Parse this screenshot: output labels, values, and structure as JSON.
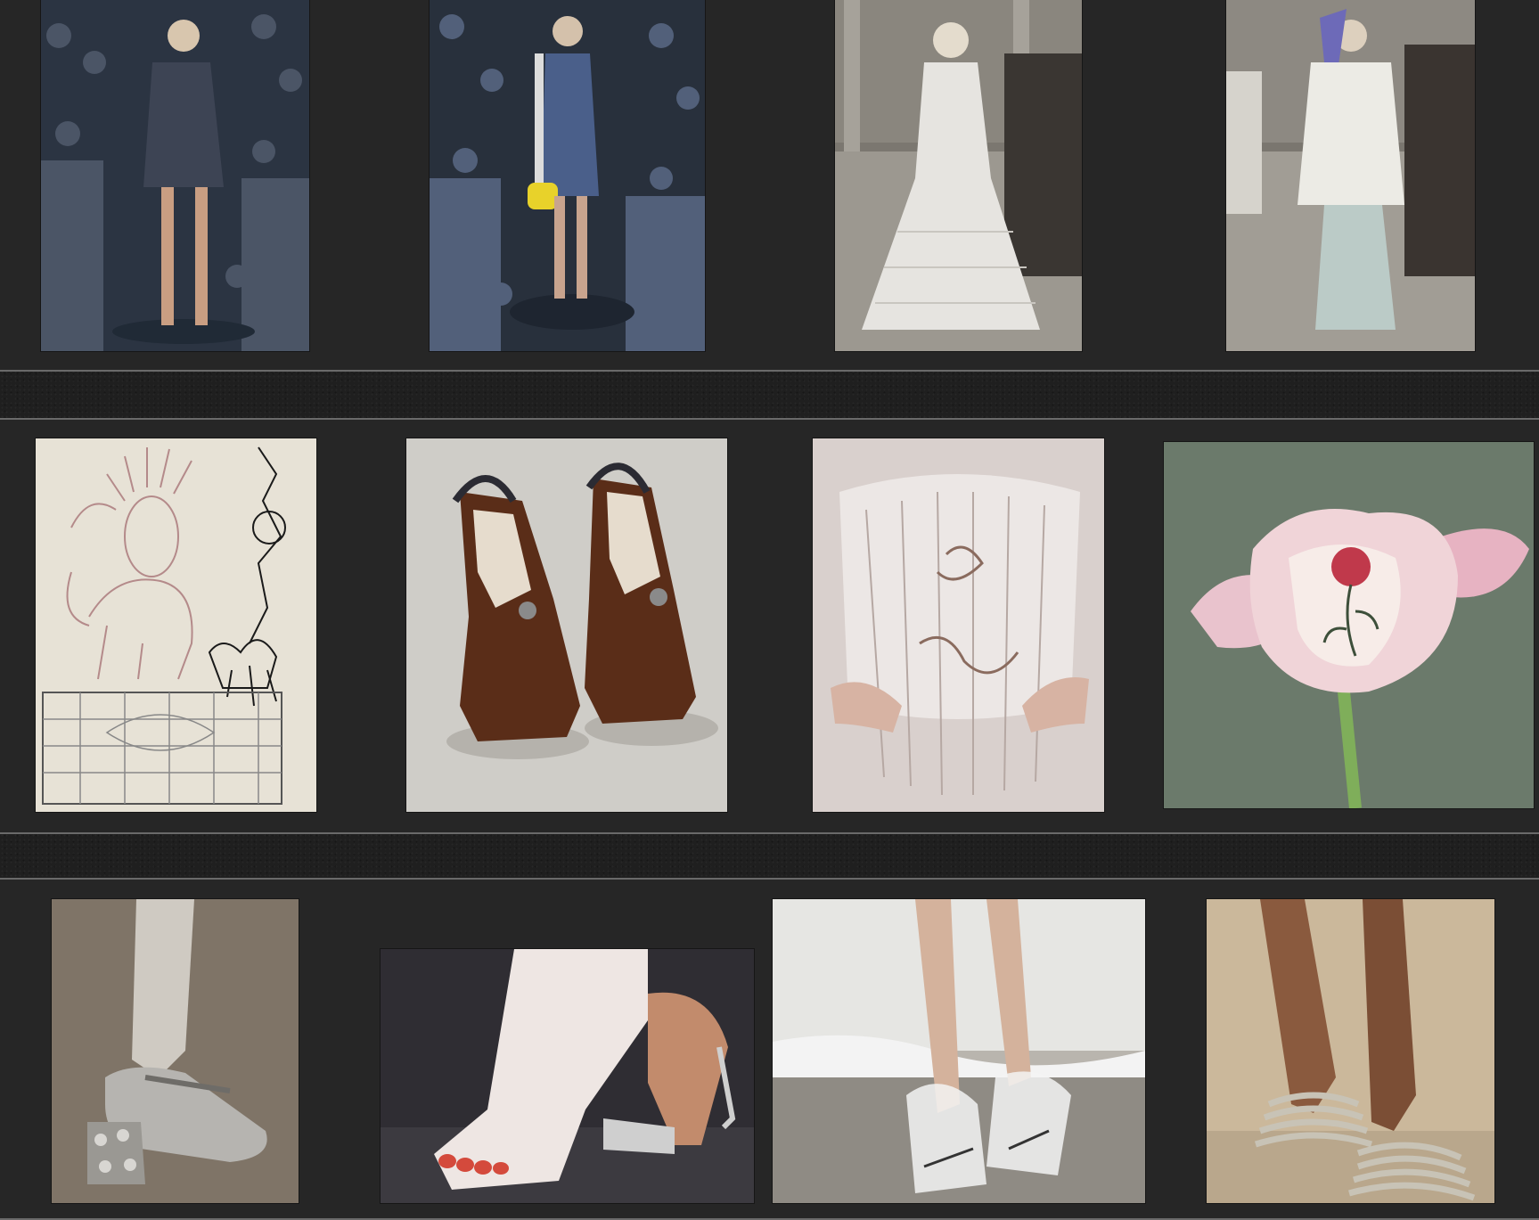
{
  "board": {
    "background": "#1f1f1f",
    "band_color": "#262626",
    "divider_color": "#6a6a6a"
  },
  "rows": [
    {
      "name": "runway-row",
      "images": [
        {
          "id": "denim-dress-crowd-photo",
          "bg": "#2b3442",
          "fg": "#4b5566"
        },
        {
          "id": "striped-minidress-yellow-bag-photo",
          "bg": "#28303c",
          "fg": "#52607a",
          "accent": "#e8d22a"
        },
        {
          "id": "white-ruffle-gown-runway-photo",
          "bg": "#7b7770",
          "fg": "#e6e4e0"
        },
        {
          "id": "white-blazer-sheer-skirt-runway-photo",
          "bg": "#7a766f",
          "fg": "#ecebe5",
          "accent": "#6d6ab8"
        }
      ]
    },
    {
      "name": "detail-row",
      "images": [
        {
          "id": "engraved-lion-and-rose-drawing",
          "bg": "#e7e2d6",
          "fg": "#b48a8a",
          "ink": "#1a1a1a"
        },
        {
          "id": "brown-toe-shoes-photo",
          "bg": "#cfcdc8",
          "fg": "#5a2d18",
          "ink": "#2b2b33"
        },
        {
          "id": "sheer-lace-corset-photo",
          "bg": "#bfb2b0",
          "fg": "#ece7e5"
        },
        {
          "id": "tattooed-rose-photo",
          "bg": "#6b7a6b",
          "fg": "#e9c3cd",
          "accent": "#c0394b"
        }
      ]
    },
    {
      "name": "shoes-row",
      "images": [
        {
          "id": "silver-jeweled-heel-photo",
          "bg": "#8b7f70",
          "fg": "#cfcac2"
        },
        {
          "id": "plaster-cast-and-heel-photo",
          "bg": "#2f2d33",
          "fg": "#eee6e3",
          "accent": "#d44a3c"
        },
        {
          "id": "plastic-bag-feet-on-shore-photo",
          "bg": "#b9b5ae",
          "fg": "#f3f3f3"
        },
        {
          "id": "gold-coil-mules-photo",
          "bg": "#cbb89b",
          "fg": "#c8c3b6"
        }
      ]
    }
  ]
}
